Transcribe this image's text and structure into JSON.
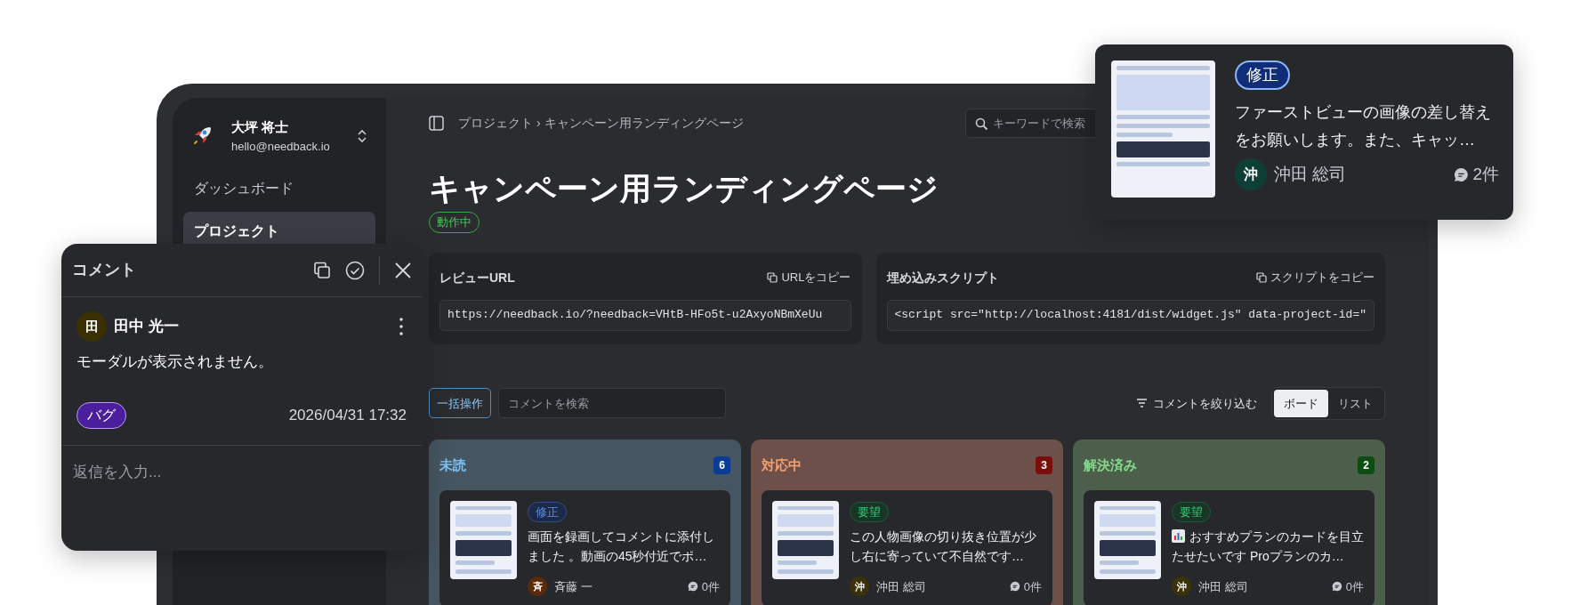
{
  "sidebar": {
    "user": {
      "name": "大坪 将士",
      "email": "hello@needback.io"
    },
    "items": [
      {
        "label": "ダッシュボード",
        "selected": false
      },
      {
        "label": "プロジェクト",
        "selected": true
      }
    ]
  },
  "breadcrumb": {
    "items": [
      "プロジェクト",
      "キャンペーン用ランディングページ"
    ],
    "separator": "›"
  },
  "search": {
    "placeholder": "キーワードで検索"
  },
  "page": {
    "title": "キャンペーン用ランディングページ",
    "status": "動作中"
  },
  "embed_cards": [
    {
      "label": "レビューURL",
      "copy_label": "URLをコピー",
      "value": "https://needback.io/?needback=VHtB-HFo5t-u2AxyoNBmXeUu"
    },
    {
      "label": "埋め込みスクリプト",
      "copy_label": "スクリプトをコピー",
      "value": "<script src=\"http://localhost:4181/dist/widget.js\" data-project-id=\""
    }
  ],
  "toolbar": {
    "bulk_button": "一括操作",
    "search_placeholder": "コメントを検索",
    "filter_label": "コメントを絞り込む",
    "views": [
      {
        "label": "ボード",
        "selected": true
      },
      {
        "label": "リスト",
        "selected": false
      }
    ]
  },
  "columns": [
    {
      "title": "未読",
      "kind": "unread",
      "count": "6",
      "cards": [
        {
          "tag": {
            "label": "修正",
            "kind": "fix"
          },
          "chart_icon": false,
          "text": "画面を録画してコメントに添付しました 。動画の45秒付近でポ…",
          "author": {
            "name": "斉藤 一",
            "initial": "斉",
            "color": "#5a2a0a"
          },
          "comments": "0件"
        }
      ]
    },
    {
      "title": "対応中",
      "kind": "in_progress",
      "count": "3",
      "cards": [
        {
          "tag": {
            "label": "要望",
            "kind": "request"
          },
          "chart_icon": false,
          "text": "この人物画像の切り抜き位置が少し右に寄っていて不自然です…",
          "author": {
            "name": "沖田 総司",
            "initial": "沖",
            "color": "#3b3208"
          },
          "comments": "0件"
        }
      ]
    },
    {
      "title": "解決済み",
      "kind": "resolved",
      "count": "2",
      "cards": [
        {
          "tag": {
            "label": "要望",
            "kind": "request"
          },
          "chart_icon": true,
          "text": "おすすめプランのカードを目立たせたいです Proプランのカ…",
          "author": {
            "name": "沖田 総司",
            "initial": "沖",
            "color": "#3b3208"
          },
          "comments": "0件"
        }
      ]
    }
  ],
  "comment_panel": {
    "title": "コメント",
    "author": {
      "name": "田中 光一",
      "initial": "田",
      "color": "#3a3004"
    },
    "body": "モーダルが表示されません。",
    "tag": {
      "label": "バグ",
      "kind": "bug"
    },
    "timestamp": "2026/04/31 17:32",
    "reply_placeholder": "返信を入力..."
  },
  "preview_card": {
    "tag": {
      "label": "修正",
      "kind": "fix"
    },
    "text": "ファーストビューの画像の差し替えをお願いします。また、キャッ…",
    "author": {
      "name": "沖田 総司",
      "initial": "沖",
      "color": "#0e3f37"
    },
    "comments": "2件"
  }
}
